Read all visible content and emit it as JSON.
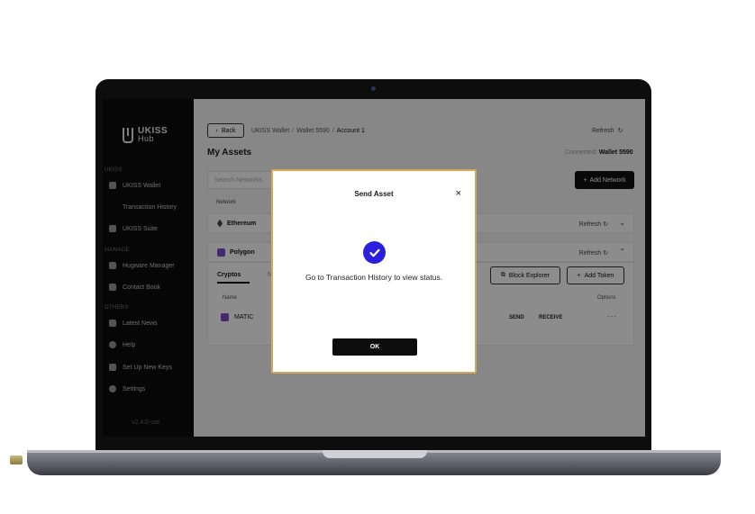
{
  "sidebar": {
    "brand": "UKISS",
    "brand_sub": "Hub",
    "sections": [
      {
        "label": "UKISS",
        "items": [
          {
            "label": "UKISS Wallet",
            "icon": "wallet-icon"
          },
          {
            "label": "Transaction History",
            "icon": ""
          },
          {
            "label": "UKISS Suite",
            "icon": "suite-icon"
          }
        ]
      },
      {
        "label": "MANAGE",
        "items": [
          {
            "label": "Hugware Manager",
            "icon": "hugware-icon"
          },
          {
            "label": "Contact Book",
            "icon": "contact-book-icon"
          }
        ]
      },
      {
        "label": "OTHERS",
        "items": [
          {
            "label": "Latest News",
            "icon": "news-icon"
          },
          {
            "label": "Help",
            "icon": "help-icon"
          },
          {
            "label": "Set Up New Keys",
            "icon": "keys-icon"
          },
          {
            "label": "Settings",
            "icon": "settings-icon"
          }
        ]
      }
    ],
    "version": "v2.4.0-uat"
  },
  "header": {
    "back_label": "Back",
    "breadcrumb": [
      "UKISS Wallet",
      "Wallet 5590",
      "Account 1"
    ],
    "refresh_label": "Refresh",
    "title": "My Assets",
    "connected_label": "Connected:",
    "connected_wallet": "Wallet 5590"
  },
  "search": {
    "placeholder": "Search Networks"
  },
  "add_network_label": "Add Network",
  "networks_header": "Network",
  "networks": [
    {
      "name": "Ethereum",
      "refresh": "Refresh"
    },
    {
      "name": "Polygon",
      "refresh": "Refresh"
    }
  ],
  "panel": {
    "tab_active": "Cryptos",
    "tab_other": "N",
    "block_explorer": "Block Explorer",
    "add_token": "Add Token",
    "col_name": "Name",
    "col_options": "Options",
    "asset": {
      "symbol": "MATIC",
      "send": "SEND",
      "receive": "RECEIVE",
      "more": "···"
    }
  },
  "modal": {
    "title": "Send Asset",
    "close": "×",
    "message": "Go to Transaction History to view status.",
    "ok_label": "OK",
    "accent": "#2b1fdc"
  }
}
